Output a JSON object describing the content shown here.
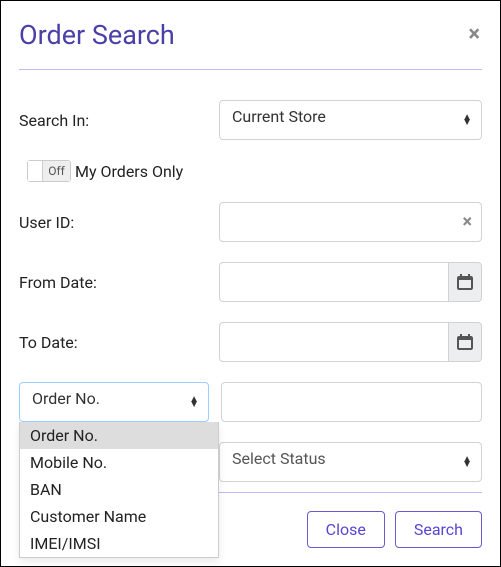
{
  "header": {
    "title": "Order Search"
  },
  "form": {
    "search_in_label": "Search In:",
    "search_in_value": "Current Store",
    "toggle_state": "Off",
    "toggle_label": "My Orders Only",
    "user_id_label": "User ID:",
    "user_id_value": "",
    "from_date_label": "From Date:",
    "from_date_value": "",
    "to_date_label": "To Date:",
    "to_date_value": "",
    "search_type_selected": "Order No.",
    "search_type_options": [
      "Order No.",
      "Mobile No.",
      "BAN",
      "Customer Name",
      "IMEI/IMSI"
    ],
    "search_value": "",
    "status_placeholder": "Select Status"
  },
  "footer": {
    "close_label": "Close",
    "search_label": "Search"
  }
}
